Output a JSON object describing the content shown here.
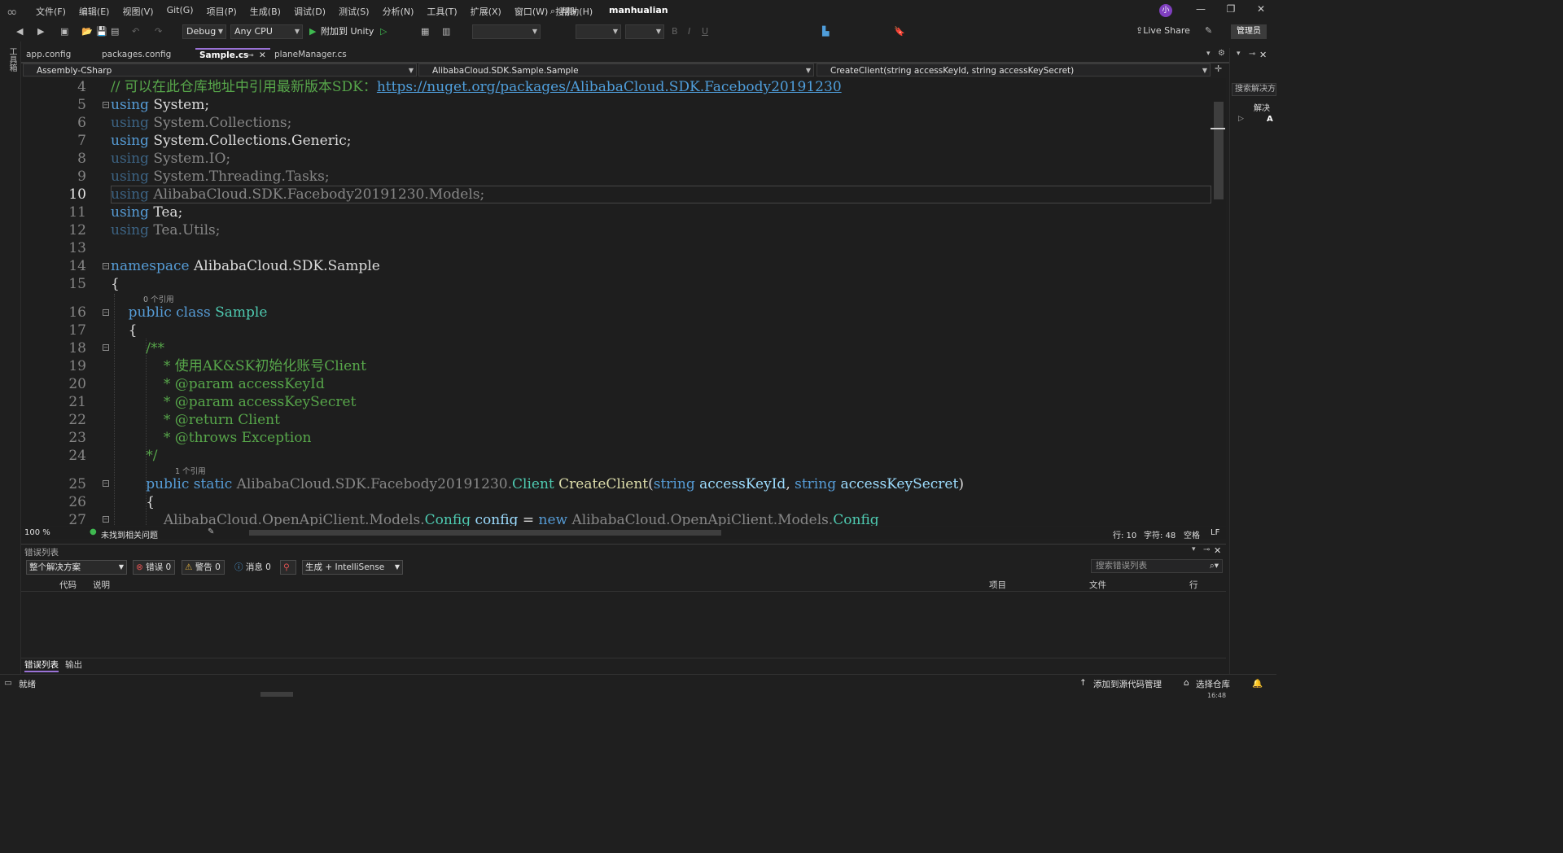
{
  "titlebar": {
    "menu": [
      "文件(F)",
      "编辑(E)",
      "视图(V)",
      "Git(G)",
      "项目(P)",
      "生成(B)",
      "调试(D)",
      "测试(S)",
      "分析(N)",
      "工具(T)",
      "扩展(X)",
      "窗口(W)",
      "帮助(H)"
    ],
    "search_label": "搜索",
    "solution_name": "manhualian",
    "avatar": "小"
  },
  "toolbar": {
    "config": "Debug",
    "platform": "Any CPU",
    "attach_label": "附加到 Unity",
    "live_share": "Live Share",
    "admin": "管理员"
  },
  "left_rail": {
    "toolbox": "工具箱"
  },
  "tabs": [
    {
      "label": "app.config",
      "active": false
    },
    {
      "label": "packages.config",
      "active": false
    },
    {
      "label": "Sample.cs",
      "active": true
    },
    {
      "label": "planeManager.cs",
      "active": false
    }
  ],
  "navbar": {
    "project": "Assembly-CSharp",
    "type": "AlibabaCloud.SDK.Sample.Sample",
    "member": "CreateClient(string accessKeyId, string accessKeySecret)"
  },
  "editor": {
    "line_numbers": [
      "4",
      "5",
      "6",
      "7",
      "8",
      "9",
      "10",
      "11",
      "12",
      "13",
      "14",
      "15",
      "16",
      "17",
      "18",
      "19",
      "20",
      "21",
      "22",
      "23",
      "24",
      "25",
      "26",
      "27"
    ],
    "current_line": "10",
    "ref0": "0 个引用",
    "ref1": "1 个引用",
    "lines": {
      "l4_comment": "// 可以在此仓库地址中引用最新版本SDK：",
      "l4_link": "https://nuget.org/packages/AlibabaCloud.SDK.Facebody20191230",
      "l5_ns": " System;",
      "l6_ns": " System.Collections;",
      "l7_ns": " System.Collections.Generic;",
      "l8_ns": " System.IO;",
      "l9_ns": " System.Threading.Tasks;",
      "l10_ns": " AlibabaCloud.SDK.Facebody20191230.Models;",
      "l11_ns": " Tea;",
      "l12_ns": " Tea.Utils;",
      "l14_ns": " AlibabaCloud.SDK.Sample",
      "l16_name": "Sample",
      "l18": "/**",
      "l19": "* 使用AK&SK初始化账号Client",
      "l20": "* @param accessKeyId",
      "l21": "* @param accessKeySecret",
      "l22": "* @return Client",
      "l23": "* @throws Exception",
      "l24": "*/",
      "l25_qual": " AlibabaCloud.SDK.Facebody20191230.",
      "l25_type": "Client",
      "l25_fn": " CreateClient",
      "l25_p1": " accessKeyId",
      "l25_p2": " accessKeySecret",
      "l27_qual": "AlibabaCloud.OpenApiClient.Models.",
      "l27_type": "Config",
      "l27_var": " config",
      "l27_qual2": " AlibabaCloud.OpenApiClient.Models.",
      "l27_type2": "Config"
    },
    "keywords": {
      "using": "using",
      "namespace": "namespace",
      "public": "public",
      "class": "class",
      "static": "static",
      "string": "string",
      "new": "new"
    }
  },
  "editor_status": {
    "zoom": "100 %",
    "issues": "未找到相关问题",
    "line": "行: 10",
    "char": "字符: 48",
    "spaces": "空格",
    "eol": "LF"
  },
  "error_list": {
    "title": "错误列表",
    "scope": "整个解决方案",
    "errors": "错误 0",
    "warnings": "警告 0",
    "messages": "消息 0",
    "build_filter": "生成 + IntelliSense",
    "search_placeholder": "搜索错误列表",
    "columns": {
      "code": "代码",
      "desc": "说明",
      "project": "项目",
      "file": "文件",
      "line": "行"
    }
  },
  "bottom_tabs": [
    "错误列表",
    "输出"
  ],
  "right_panel": {
    "search": "搜索解决方",
    "item1": "解决",
    "item2": "A"
  },
  "statusbar": {
    "ready": "就绪",
    "source_control": "添加到源代码管理",
    "repo": "选择仓库",
    "time": "16:48"
  },
  "colors": {
    "accent": "#9a72d6",
    "keyword": "#569cd6",
    "type": "#4ec9b0",
    "comment": "#57a64a",
    "method": "#dcdcaa"
  }
}
